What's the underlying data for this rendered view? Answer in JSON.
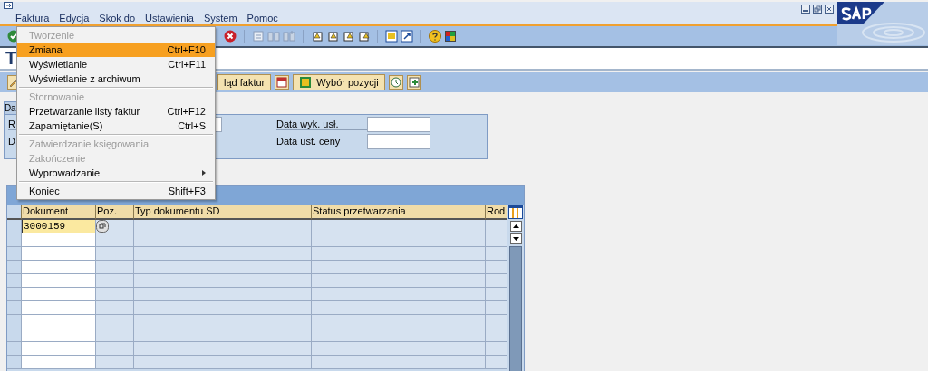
{
  "menubar": [
    "Faktura",
    "Edycja",
    "Skok do",
    "Ustawienia",
    "System",
    "Pomoc"
  ],
  "title": "T",
  "app_toolbar": {
    "buttons": [
      {
        "label": "ląd faktur",
        "kind": "text"
      },
      {
        "kind": "icon"
      },
      {
        "label": "Wybór pozycji",
        "kind": "text"
      },
      {
        "kind": "icon"
      },
      {
        "kind": "icon"
      }
    ]
  },
  "selection_frame": {
    "tab": "Da",
    "left_labels": [
      "R",
      "D"
    ],
    "fields": [
      {
        "label": "Data wyk. usł."
      },
      {
        "label": "Data ust. ceny"
      }
    ]
  },
  "table": {
    "columns": [
      "Dokument",
      "Poz.",
      "Typ dokumentu SD",
      "Status przetwarzania",
      "Rod"
    ],
    "rows": [
      {
        "dokument": "3000159",
        "selected": true
      }
    ]
  },
  "dropdown_menu": {
    "items": [
      {
        "kind": "item",
        "label": "Tworzenie",
        "disabled": true,
        "selected": false
      },
      {
        "kind": "item",
        "label": "Zmiana",
        "shortcut": "Ctrl+F10",
        "disabled": false,
        "selected": true
      },
      {
        "kind": "item",
        "label": "Wyświetlanie",
        "shortcut": "Ctrl+F11",
        "disabled": false,
        "selected": false
      },
      {
        "kind": "item",
        "label": "Wyświetlanie z archiwum",
        "disabled": false,
        "selected": false
      },
      {
        "kind": "separator"
      },
      {
        "kind": "item",
        "label": "Stornowanie",
        "disabled": true,
        "selected": false
      },
      {
        "kind": "item",
        "label": "Przetwarzanie listy faktur",
        "shortcut": "Ctrl+F12",
        "disabled": false,
        "selected": false
      },
      {
        "kind": "item",
        "label": "Zapamiętanie(S)",
        "shortcut": "Ctrl+S",
        "disabled": false,
        "selected": false
      },
      {
        "kind": "separator"
      },
      {
        "kind": "item",
        "label": "Zatwierdzanie księgowania",
        "disabled": true,
        "selected": false
      },
      {
        "kind": "item",
        "label": "Zakończenie",
        "disabled": true,
        "selected": false
      },
      {
        "kind": "item",
        "label": "Wyprowadzanie",
        "submenu": true,
        "disabled": false,
        "selected": false
      },
      {
        "kind": "separator"
      },
      {
        "kind": "item",
        "label": "Koniec",
        "shortcut": "Shift+F3",
        "disabled": false,
        "selected": false
      }
    ]
  }
}
